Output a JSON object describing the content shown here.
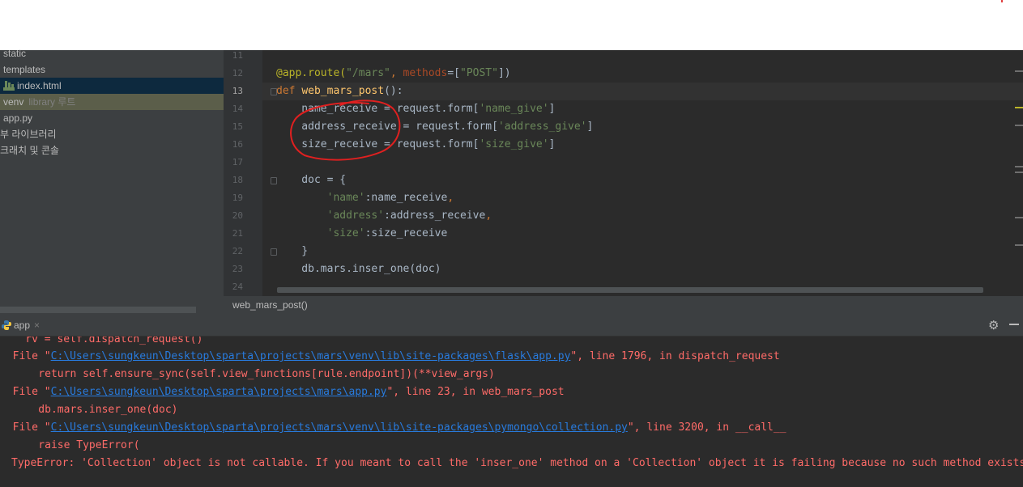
{
  "sidebar": {
    "items": [
      {
        "label": "static"
      },
      {
        "label": "templates"
      },
      {
        "label": "index.html"
      },
      {
        "label": "venv",
        "suffix": "library 루트"
      },
      {
        "label": "app.py"
      },
      {
        "label": "부 라이브러리"
      },
      {
        "label": "크래치 및 콘솔"
      }
    ]
  },
  "editor": {
    "line_numbers": [
      "11",
      "12",
      "13",
      "14",
      "15",
      "16",
      "17",
      "18",
      "19",
      "20",
      "21",
      "22",
      "23",
      "24"
    ],
    "lines": {
      "l12": {
        "a": "@app.route(",
        "b": "\"/mars\"",
        "c": ", ",
        "d": "methods",
        "e": "=[",
        "f": "\"POST\"",
        "g": "])"
      },
      "l13": {
        "a": "def ",
        "b": "web_mars_post",
        "c": "():"
      },
      "l14": {
        "a": "    name_receive = request.form[",
        "b": "'name_give'",
        "c": "]"
      },
      "l15": {
        "a": "    address_receive = request.form[",
        "b": "'address_give'",
        "c": "]"
      },
      "l16": {
        "a": "    size_receive = request.form[",
        "b": "'size_give'",
        "c": "]"
      },
      "l18": {
        "a": "    doc = {"
      },
      "l19": {
        "a": "        ",
        "b": "'name'",
        "c": ":name_receive",
        "d": ","
      },
      "l20": {
        "a": "        ",
        "b": "'address'",
        "c": ":address_receive",
        "d": ","
      },
      "l21": {
        "a": "        ",
        "b": "'size'",
        "c": ":size_receive"
      },
      "l22": {
        "a": "    }"
      },
      "l23": {
        "a": "    db.mars.inser_one(doc)"
      }
    }
  },
  "breadcrumb": {
    "label": "web_mars_post()"
  },
  "run": {
    "tab_label": "app",
    "close": "×",
    "gear": "⚙"
  },
  "console": {
    "l0": "    rv = self.dispatch_request()",
    "l1": {
      "a": "  File \"",
      "b": "C:\\Users\\sungkeun\\Desktop\\sparta\\projects\\mars\\venv\\lib\\site-packages\\flask\\app.py",
      "c": "\", line 1796, in dispatch_request"
    },
    "l2": "    return self.ensure_sync(self.view_functions[rule.endpoint])(**view_args)",
    "l3": {
      "a": "  File \"",
      "b": "C:\\Users\\sungkeun\\Desktop\\sparta\\projects\\mars\\app.py",
      "c": "\", line 23, in web_mars_post"
    },
    "l4": "    db.mars.inser_one(doc)",
    "l5": {
      "a": "  File \"",
      "b": "C:\\Users\\sungkeun\\Desktop\\sparta\\projects\\mars\\venv\\lib\\site-packages\\pymongo\\collection.py",
      "c": "\", line 3200, in __call__"
    },
    "l6": "    raise TypeError(",
    "l7": "TypeError: 'Collection' object is not callable. If you meant to call the 'inser_one' method on a 'Collection' object it is failing because no such method exists."
  },
  "colors": {
    "annotation": "#e02020",
    "error_text": "#ff6b68",
    "link": "#287bde"
  }
}
